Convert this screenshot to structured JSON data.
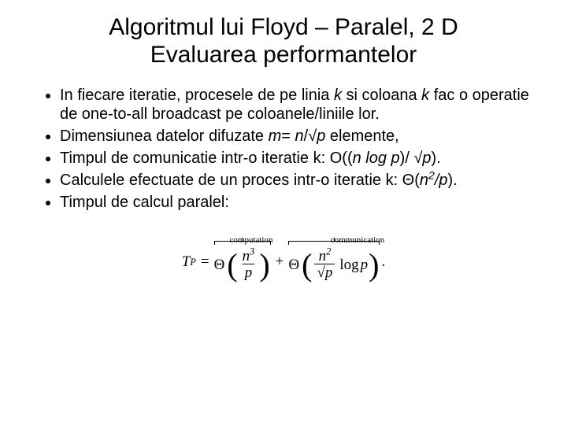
{
  "title_line1": "Algoritmul lui Floyd – Paralel, 2 D",
  "title_line2": "Evaluarea performantelor",
  "bullets": {
    "b1_pre": "In fiecare iteratie, procesele de pe linia ",
    "b1_k1": "k",
    "b1_mid1": " si coloana ",
    "b1_k2": "k",
    "b1_post": " fac o operatie de one-to-all broadcast pe coloanele/liniile lor.",
    "b2_pre": "Dimensiunea datelor difuzate ",
    "b2_m": "m",
    "b2_eq": "= ",
    "b2_n": "n",
    "b2_slash": "/√",
    "b2_p": "p",
    "b2_post": " elemente,",
    "b3_pre": "Timpul de comunicatie intr-o iteratie k: O((",
    "b3_n": "n",
    "b3_log": " log p",
    "b3_mid": ")/ √",
    "b3_p": "p",
    "b3_post": ").",
    "b4_pre": "Calculele efectuate de un proces intr-o iteratie k: Θ(",
    "b4_n": "n",
    "b4_exp": "2",
    "b4_slash": "/",
    "b4_p": "p",
    "b4_post": ").",
    "b5": "Timpul de calcul paralel:"
  },
  "formula": {
    "label_computation": "computation",
    "label_communication": "communication",
    "Tp": "T",
    "Tp_sub": "P",
    "equals": " = ",
    "theta": "Θ",
    "lparen": "(",
    "rparen": ")",
    "frac1_num_n": "n",
    "frac1_num_exp": "3",
    "frac1_den": "p",
    "plus": " + ",
    "frac2_num_n": "n",
    "frac2_num_exp": "2",
    "frac2_den_radic": "√",
    "frac2_den_p": "p",
    "log": "log",
    "log_p": "p",
    "period": "."
  }
}
